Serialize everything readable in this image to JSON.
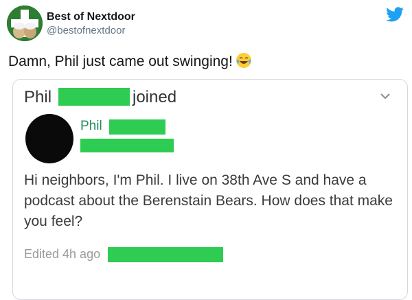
{
  "tweet": {
    "display_name": "Best of Nextdoor",
    "handle": "@bestofnextdoor",
    "text": "Damn, Phil just came out swinging!",
    "emoji": "face-with-tears-of-joy-icon"
  },
  "post": {
    "header_name": "Phil",
    "header_action": "joined",
    "author_name": "Phil",
    "body": "Hi neighbors, I'm Phil. I live on 38th Ave S and have a podcast about the Berenstain Bears. How does that make you feel?",
    "edited": "Edited 4h ago"
  },
  "colors": {
    "redaction": "#2ecc52",
    "twitter_blue": "#1da1f2",
    "author_green": "#1e8e5b"
  }
}
